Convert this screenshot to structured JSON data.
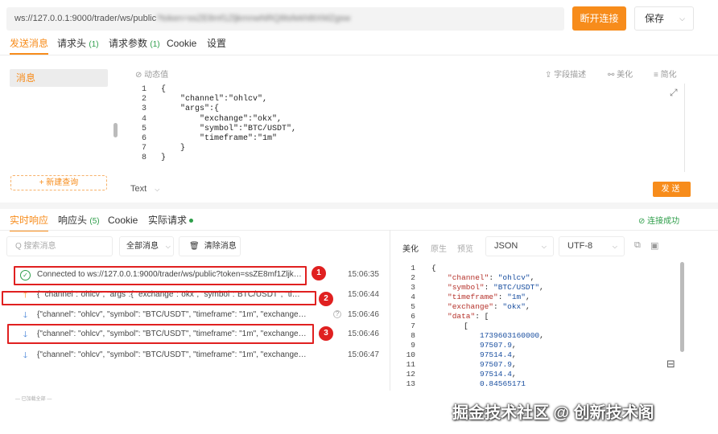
{
  "top": {
    "url_prefix": "ws://127.0.0.1:9000/trader/ws/public",
    "url_blurred": "?token=ssZE8mf1ZljkmnwNRQ8tsfekh8tXMZgsw",
    "disconnect_label": "断开连接",
    "save_label": "保存"
  },
  "request_tabs": [
    {
      "label": "发送消息",
      "count": ""
    },
    {
      "label": "请求头",
      "count": "(1)"
    },
    {
      "label": "请求参数",
      "count": "(1)"
    },
    {
      "label": "Cookie",
      "count": ""
    },
    {
      "label": "设置",
      "count": ""
    }
  ],
  "left_panel": {
    "message_item": "消息",
    "new_query": "+ 新建查询"
  },
  "editor_toolbar": {
    "dynamic_value": "⊘ 动态值",
    "describe": "⇪ 字段描述",
    "beautify": "⚯ 美化",
    "minify": "≡ 简化"
  },
  "request_code": [
    "{",
    "    \"channel\":\"ohlcv\",",
    "    \"args\":{",
    "        \"exchange\":\"okx\",",
    "        \"symbol\":\"BTC/USDT\",",
    "        \"timeframe\":\"1m\"",
    "    }",
    "}"
  ],
  "format_select": "Text",
  "send_label": "发送",
  "response_tabs": [
    {
      "label": "实时响应",
      "count": ""
    },
    {
      "label": "响应头",
      "count": "(5)"
    },
    {
      "label": "Cookie",
      "count": ""
    },
    {
      "label": "实际请求",
      "count": ""
    }
  ],
  "connection_status": "⊘ 连接成功",
  "filters": {
    "search_placeholder": "Q 搜索消息",
    "all_messages": "全部消息",
    "clear_messages": "清除消息"
  },
  "messages": [
    {
      "type": "connected",
      "text": "Connected to ws://127.0.0.1:9000/trader/ws/public?token=ssZE8mf1ZljkmnwNRQ...",
      "time": "15:06:35"
    },
    {
      "type": "sent",
      "text": "{ \"channel\":\"ohlcv\", \"args\":{ \"exchange\":\"okx\", \"symbol\":\"BTC/USDT\", \"timeframe\":...",
      "time": "15:06:44"
    },
    {
      "type": "received",
      "text": "{\"channel\": \"ohlcv\", \"symbol\": \"BTC/USDT\", \"timeframe\": \"1m\", \"exchange\": \"okx\", \"...",
      "time": "15:06:46"
    },
    {
      "type": "received",
      "text": "{\"channel\": \"ohlcv\", \"symbol\": \"BTC/USDT\", \"timeframe\": \"1m\", \"exchange\": \"okx\", \"...",
      "time": "15:06:46"
    },
    {
      "type": "received",
      "text": "{\"channel\": \"ohlcv\", \"symbol\": \"BTC/USDT\", \"timeframe\": \"1m\", \"exchange\": \"okx\", \"...",
      "time": "15:06:47"
    }
  ],
  "annotations": [
    "1",
    "2",
    "3"
  ],
  "footer_note": "— 已加载全部 —",
  "response_panel": {
    "tabs": [
      "美化",
      "原生",
      "预览"
    ],
    "format": "JSON",
    "encoding": "UTF-8"
  },
  "response_code": [
    {
      "n": "1",
      "indent": 0,
      "key": "",
      "val": "",
      "punct": "{"
    },
    {
      "n": "2",
      "indent": 1,
      "key": "\"channel\"",
      "val": "\"ohlcv\"",
      "punct": ","
    },
    {
      "n": "3",
      "indent": 1,
      "key": "\"symbol\"",
      "val": "\"BTC/USDT\"",
      "punct": ","
    },
    {
      "n": "4",
      "indent": 1,
      "key": "\"timeframe\"",
      "val": "\"1m\"",
      "punct": ","
    },
    {
      "n": "5",
      "indent": 1,
      "key": "\"exchange\"",
      "val": "\"okx\"",
      "punct": ","
    },
    {
      "n": "6",
      "indent": 1,
      "key": "\"data\"",
      "val": "",
      "punct": "["
    },
    {
      "n": "7",
      "indent": 2,
      "key": "",
      "val": "",
      "punct": "["
    },
    {
      "n": "8",
      "indent": 3,
      "key": "",
      "val": "1739603160000",
      "punct": ","
    },
    {
      "n": "9",
      "indent": 3,
      "key": "",
      "val": "97507.9",
      "punct": ","
    },
    {
      "n": "10",
      "indent": 3,
      "key": "",
      "val": "97514.4",
      "punct": ","
    },
    {
      "n": "11",
      "indent": 3,
      "key": "",
      "val": "97507.9",
      "punct": ","
    },
    {
      "n": "12",
      "indent": 3,
      "key": "",
      "val": "97514.4",
      "punct": ","
    },
    {
      "n": "13",
      "indent": 3,
      "key": "",
      "val": "0.84565171",
      "punct": ""
    }
  ],
  "watermark": "掘金技术社区 @ 创新技术阁",
  "colors": {
    "accent": "#f78c1b",
    "success": "#2e9e4a",
    "annotation": "#e02020"
  }
}
